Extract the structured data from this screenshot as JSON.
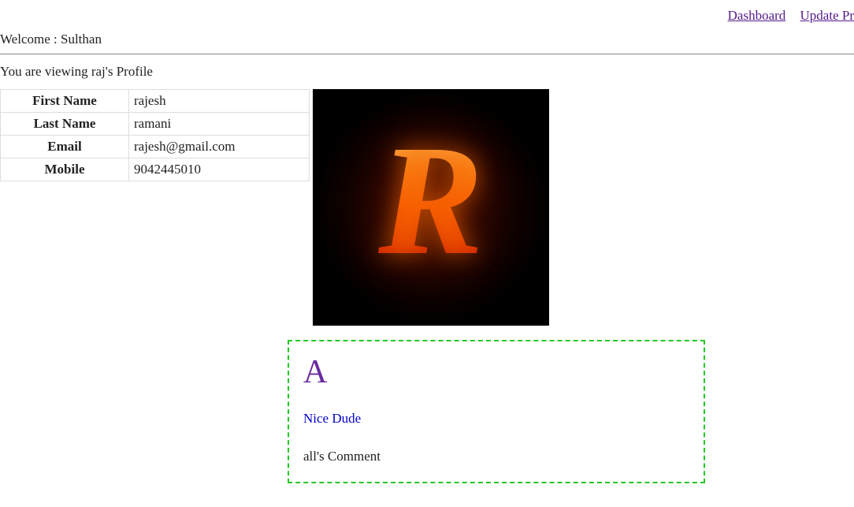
{
  "nav": {
    "dashboard": "Dashboard",
    "update_profile": "Update Pr"
  },
  "welcome": {
    "prefix": "Welcome : ",
    "user": "Sulthan"
  },
  "viewing": "You are viewing raj's Profile",
  "profile": {
    "labels": {
      "first_name": "First Name",
      "last_name": "Last Name",
      "email": "Email",
      "mobile": "Mobile"
    },
    "first_name": "rajesh",
    "last_name": "ramani",
    "email": "rajesh@gmail.com",
    "mobile": "9042445010"
  },
  "avatar": {
    "letter": "R"
  },
  "comment": {
    "avatar_letter": "A",
    "text": "Nice Dude",
    "author_line": "all's Comment"
  }
}
